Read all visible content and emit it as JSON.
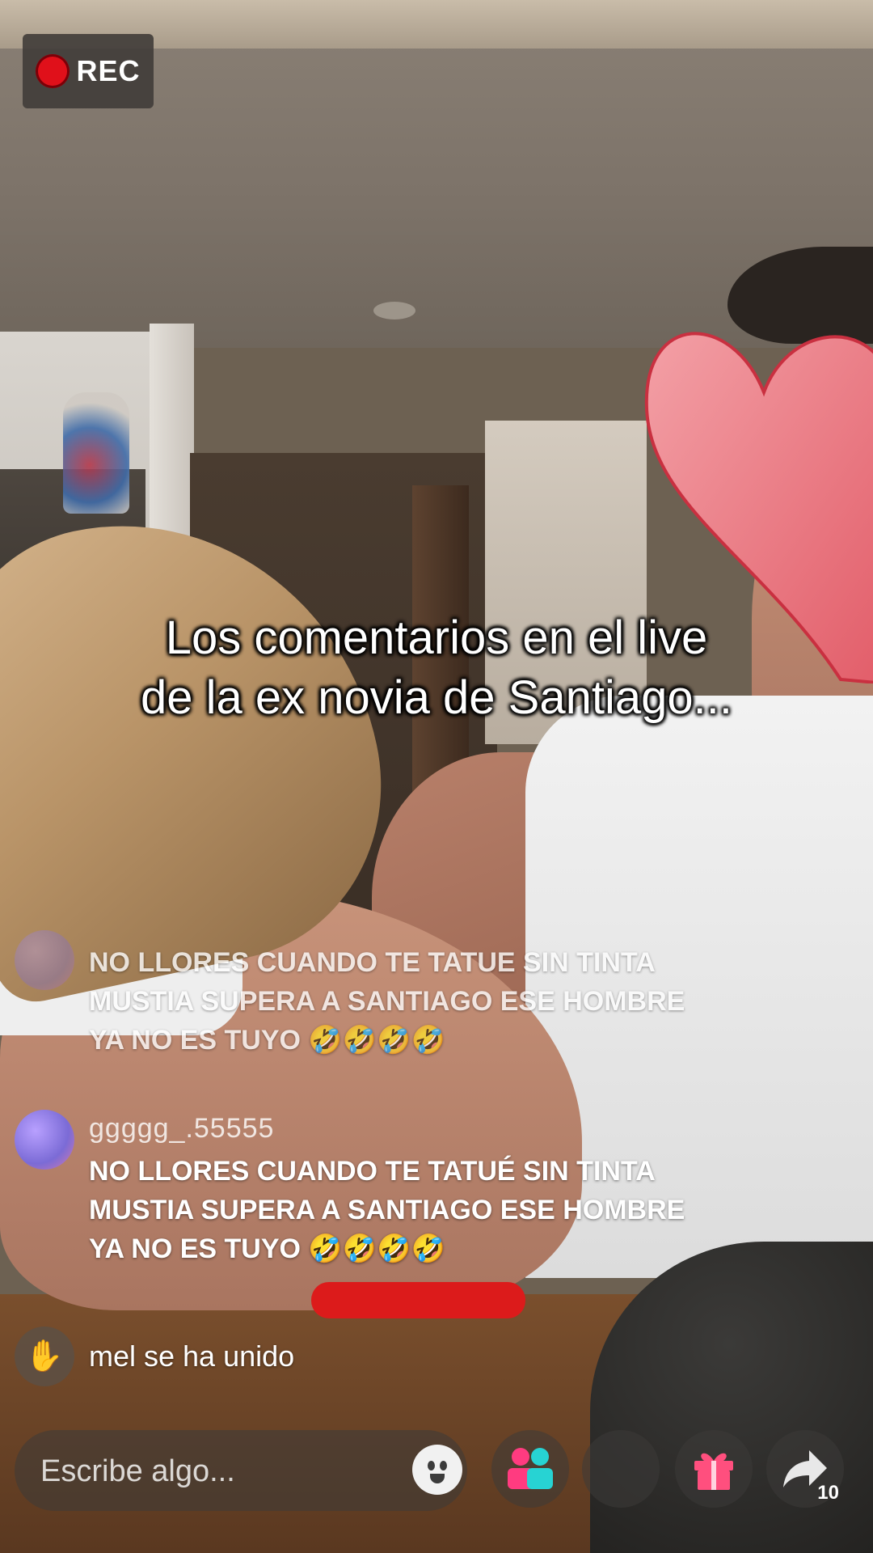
{
  "recording": {
    "label": "REC",
    "color": "#e0101a"
  },
  "caption": {
    "line1": "Los comentarios en el live",
    "line2": "de la ex novia de Santiago..."
  },
  "comments": [
    {
      "user": "",
      "lines": [
        "NO LLORES CUANDO TE TATUE SIN TINTA",
        "MUSTIA SUPERA A SANTIAGO ESE HOMBRE",
        "YA NO ES TUYO 🤣🤣🤣🤣"
      ]
    },
    {
      "user": "ggggg_.55555",
      "lines": [
        "NO LLORES CUANDO TE TATUÉ SIN TINTA",
        "MUSTIA SUPERA A SANTIAGO ESE HOMBRE",
        "YA NO ES TUYO 🤣🤣🤣🤣"
      ]
    }
  ],
  "joined_notice": {
    "icon": "wave-hand-icon",
    "text": "mel se ha unido"
  },
  "input": {
    "placeholder": "Escribe algo..."
  },
  "actions": {
    "emoji_icon": "smiley-icon",
    "guests_icon": "users-icon",
    "gift_icon": "gift-icon",
    "share_icon": "share-arrow-icon",
    "share_count": "10"
  }
}
